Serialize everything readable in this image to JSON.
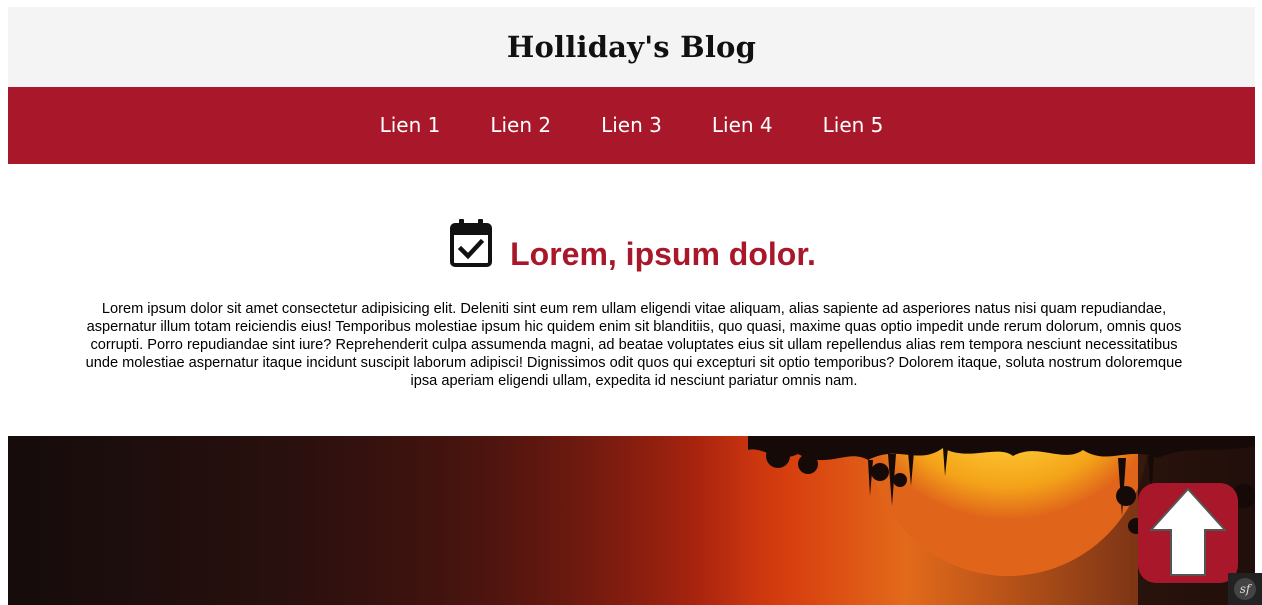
{
  "header": {
    "title": "Holliday's Blog"
  },
  "nav": {
    "links": [
      {
        "label": "Lien 1"
      },
      {
        "label": "Lien 2"
      },
      {
        "label": "Lien 3"
      },
      {
        "label": "Lien 4"
      },
      {
        "label": "Lien 5"
      }
    ],
    "background_color": "#a8182a"
  },
  "article": {
    "icon": "calendar-check-icon",
    "title": "Lorem, ipsum dolor.",
    "title_color": "#a8182a",
    "body": "Lorem ipsum dolor sit amet consectetur adipisicing elit. Deleniti sint eum rem ullam eligendi vitae aliquam, alias sapiente ad asperiores natus nisi quam repudiandae, aspernatur illum totam reiciendis eius! Temporibus molestiae ipsum hic quidem enim sit blanditiis, quo quasi, maxime quas optio impedit unde rerum dolorum, omnis quos corrupti. Porro repudiandae sint iure? Reprehenderit culpa assumenda magni, ad beatae voluptates eius sit ullam repellendus alias rem tempora nesciunt necessitatibus unde molestiae aspernatur itaque incidunt suscipit laborum adipisci! Dignissimos odit quos qui excepturi sit optio temporibus? Dolorem itaque, soluta nostrum doloremque ipsa aperiam eligendi ullam, expedita id nesciunt pariatur omnis nam."
  },
  "hero": {
    "subject": "sunset-image"
  },
  "back_to_top": {
    "icon": "arrow-up-icon",
    "color": "#a8182a"
  },
  "debug_toolbar": {
    "icon": "symfony-icon",
    "label": "sf"
  }
}
